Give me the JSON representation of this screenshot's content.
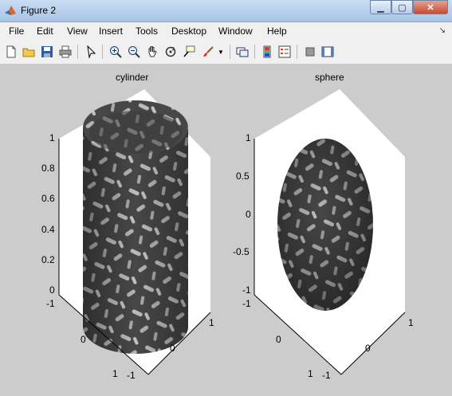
{
  "window": {
    "title": "Figure 2",
    "minimize_icon": "minimize-icon",
    "maximize_icon": "maximize-icon",
    "close_icon": "close-icon"
  },
  "menu": {
    "items": [
      "File",
      "Edit",
      "View",
      "Insert",
      "Tools",
      "Desktop",
      "Window",
      "Help"
    ]
  },
  "toolbar": {
    "buttons": [
      "new-figure-icon",
      "open-file-icon",
      "save-icon",
      "print-icon",
      "edit-plot-arrow-icon",
      "zoom-in-icon",
      "zoom-out-icon",
      "pan-hand-icon",
      "rotate-3d-icon",
      "data-cursor-icon",
      "brush-icon",
      "brush-menu-arrow-icon",
      "link-plot-icon",
      "colorbar-icon",
      "legend-icon",
      "hide-plot-tools-icon",
      "show-plot-tools-icon"
    ]
  },
  "plots": {
    "cylinder": {
      "title": "cylinder",
      "z_ticks": [
        "1",
        "0.8",
        "0.6",
        "0.4",
        "0.2",
        "0"
      ],
      "x_ticks": [
        "-1",
        "0",
        "1"
      ],
      "y_ticks": [
        "1",
        "0",
        "-1"
      ]
    },
    "sphere": {
      "title": "sphere",
      "z_ticks": [
        "1",
        "0.5",
        "0",
        "-0.5",
        "-1"
      ],
      "x_ticks": [
        "-1",
        "0",
        "1"
      ],
      "y_ticks": [
        "1",
        "0",
        "-1"
      ]
    }
  },
  "colors": {
    "figure_bg": "#cccccc",
    "surface": "#4a4a4a",
    "patch": "#bdbdbd"
  }
}
